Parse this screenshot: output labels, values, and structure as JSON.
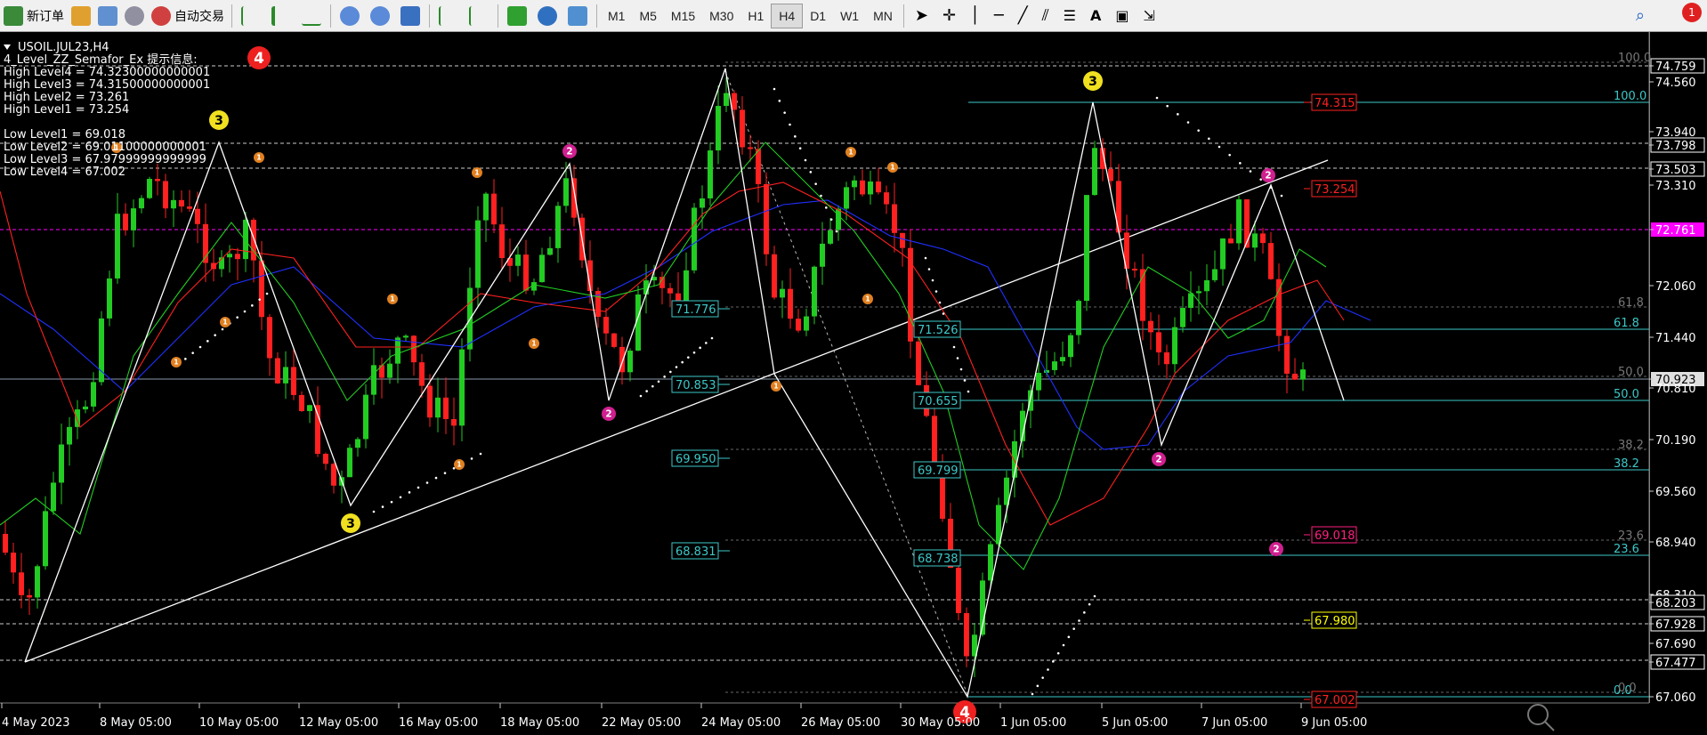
{
  "toolbar": {
    "new_order": "新订单",
    "auto_trading": "自动交易",
    "timeframes": [
      "M1",
      "M5",
      "M15",
      "M30",
      "H1",
      "H4",
      "D1",
      "W1",
      "MN"
    ],
    "active_timeframe": "H4",
    "notification_count": "1"
  },
  "chart": {
    "symbol_title": "USOIL.JUL23,H4",
    "indicator_title": "4_Level_ZZ_Semafor_Ex 提示信息:",
    "info_lines": [
      "High Level4 = 74.32300000000001",
      "High Level3 = 74.31500000000001",
      "High Level2 = 73.261",
      "High Level1 = 73.254",
      "",
      "Low Level1 = 69.018",
      "Low Level2 = 69.01100000000001",
      "Low Level3 = 67.97999999999999",
      "Low Level4 = 67.002"
    ],
    "price_axis": [
      "74.759",
      "74.560",
      "73.940",
      "73.798",
      "73.503",
      "73.310",
      "72.761",
      "72.060",
      "71.440",
      "70.923",
      "70.810",
      "70.190",
      "69.560",
      "68.940",
      "68.310",
      "68.203",
      "67.928",
      "67.690",
      "67.477",
      "67.060"
    ],
    "time_axis": [
      "4 May 2023",
      "8 May 05:00",
      "10 May 05:00",
      "12 May 05:00",
      "16 May 05:00",
      "18 May 05:00",
      "22 May 05:00",
      "24 May 05:00",
      "26 May 05:00",
      "30 May 05:00",
      "1 Jun 05:00",
      "5 Jun 05:00",
      "7 Jun 05:00",
      "9 Jun 05:00"
    ],
    "fib_labels_left": [
      "71.776",
      "70.853",
      "69.950",
      "68.831"
    ],
    "fib_labels_right": [
      "71.526",
      "70.655",
      "69.799",
      "68.738"
    ],
    "fib_levels": [
      "100.0",
      "61.8",
      "50.0",
      "38.2",
      "23.6",
      "0.0"
    ],
    "level_boxes": [
      {
        "text": "74.315",
        "color": "#ff2020"
      },
      {
        "text": "73.254",
        "color": "#ff2020"
      },
      {
        "text": "69.018",
        "color": "#ff2080"
      },
      {
        "text": "67.980",
        "color": "#ffff00"
      },
      {
        "text": "67.002",
        "color": "#ff2020"
      }
    ],
    "semafor_marks": [
      "1",
      "2",
      "3",
      "4"
    ]
  },
  "colors": {
    "bull": "#22cc22",
    "bear": "#ff2020",
    "cyan": "#3cc8c8",
    "magenta_line": "#ff00ff",
    "current_price_bg": "#e0e0e0"
  }
}
